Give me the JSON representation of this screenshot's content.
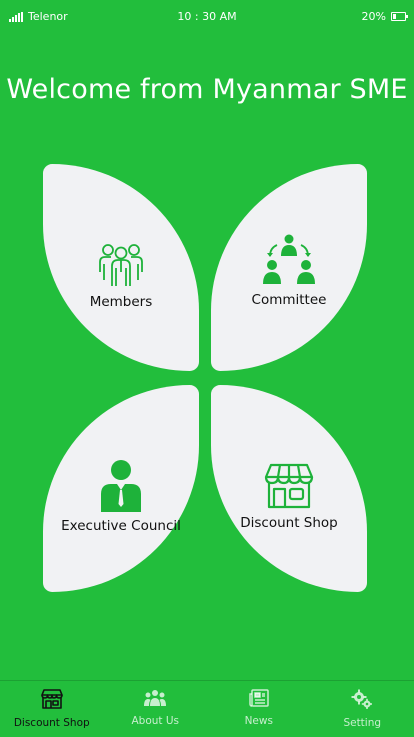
{
  "status_bar": {
    "carrier": "Telenor",
    "time": "10 : 30 AM",
    "battery": "20%"
  },
  "welcome": {
    "title": "Welcome from Myanmar SME"
  },
  "tiles": {
    "members": {
      "label": "Members",
      "icon": "members-icon"
    },
    "committee": {
      "label": "Committee",
      "icon": "committee-icon"
    },
    "executive_council": {
      "label": "Executive Council",
      "icon": "executive-council-icon"
    },
    "discount_shop": {
      "label": "Discount Shop",
      "icon": "shop-icon"
    }
  },
  "tabbar": {
    "active": "discount_shop",
    "items": [
      {
        "id": "discount_shop",
        "label": "Discount Shop",
        "icon": "shop-icon"
      },
      {
        "id": "about_us",
        "label": "About Us",
        "icon": "group-icon"
      },
      {
        "id": "news",
        "label": "News",
        "icon": "newspaper-icon"
      },
      {
        "id": "setting",
        "label": "Setting",
        "icon": "gears-icon"
      }
    ]
  },
  "colors": {
    "background": "#22be3c",
    "tile": "#f1f2f4",
    "icon_green": "#1eb23a"
  }
}
